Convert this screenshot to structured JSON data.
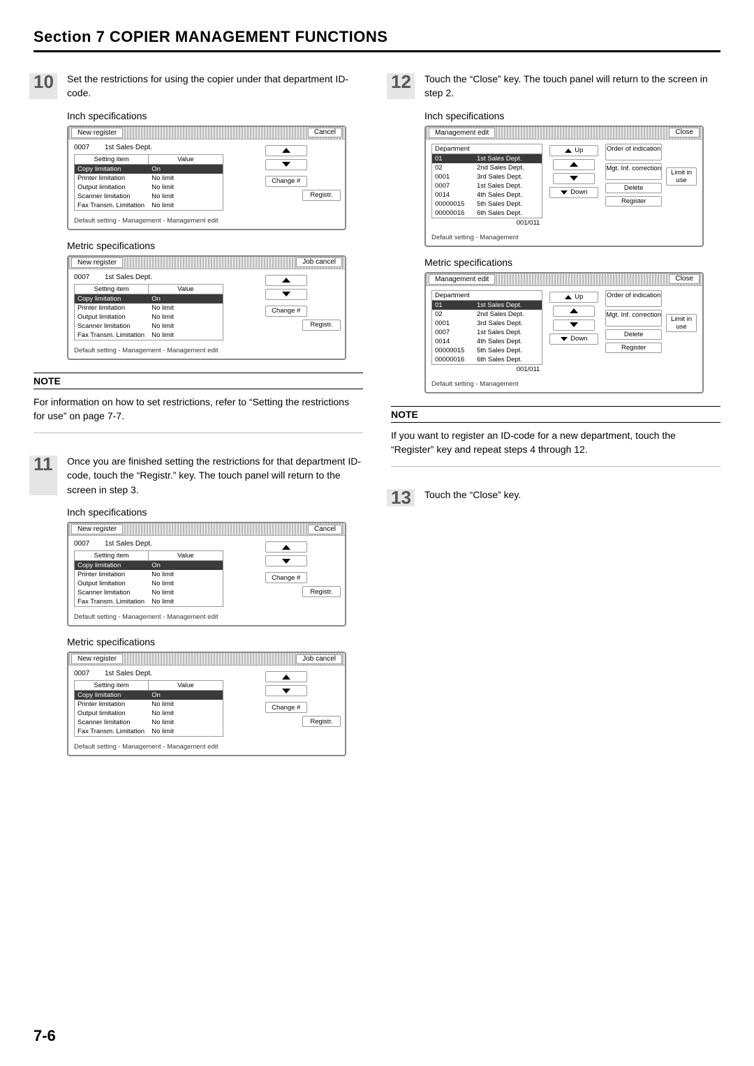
{
  "header": {
    "section_title": "Section 7  COPIER MANAGEMENT FUNCTIONS"
  },
  "labels": {
    "inch_spec": "Inch specifications",
    "metric_spec": "Metric specifications",
    "note": "NOTE"
  },
  "steps": {
    "s10": {
      "num": "10",
      "text": "Set the restrictions for using the copier under that department ID-code."
    },
    "s11": {
      "num": "11",
      "text": "Once you are finished setting the restrictions for that department ID-code, touch the “Registr.” key.\nThe touch panel will return to the screen in step 3."
    },
    "s12": {
      "num": "12",
      "text": "Touch the “Close” key.\nThe touch panel will return to the screen in step 2."
    },
    "s13": {
      "num": "13",
      "text": "Touch the “Close” key."
    }
  },
  "notes": {
    "left": "For information on how to set restrictions, refer to “Setting the restrictions for use” on page 7-7.",
    "right": "If you want to register an ID-code for a new department, touch the “Register” key and repeat steps 4 through 12."
  },
  "panel_register": {
    "title": "New register",
    "cancel": "Cancel",
    "job_cancel": "Job cancel",
    "dept_id": "0007",
    "dept_name": "1st Sales Dept.",
    "col_item": "Setting item",
    "col_value": "Value",
    "rows": [
      {
        "item": "Copy limitation",
        "value": "On",
        "sel": true
      },
      {
        "item": "Printer limitation",
        "value": "No limit",
        "sel": false
      },
      {
        "item": "Output limitation",
        "value": "No limit",
        "sel": false
      },
      {
        "item": "Scanner limitation",
        "value": "No limit",
        "sel": false
      },
      {
        "item": "Fax Transm. Limitation",
        "value": "No limit",
        "sel": false
      }
    ],
    "change": "Change #",
    "registr": "Registr.",
    "footer": "Default setting - Management - Management edit"
  },
  "panel_mgmt": {
    "title": "Management edit",
    "close": "Close",
    "dept_hdr": "Department",
    "rows": [
      {
        "id": "01",
        "name": "1st Sales Dept.",
        "sel": true
      },
      {
        "id": "02",
        "name": "2nd Sales Dept.",
        "sel": false
      },
      {
        "id": "0001",
        "name": "3rd Sales Dept.",
        "sel": false
      },
      {
        "id": "0007",
        "name": "1st Sales Dept.",
        "sel": false
      },
      {
        "id": "0014",
        "name": "4th Sales Dept.",
        "sel": false
      },
      {
        "id": "00000015",
        "name": "5th Sales Dept.",
        "sel": false
      },
      {
        "id": "00000016",
        "name": "6th Sales Dept.",
        "sel": false
      }
    ],
    "counter": "001/011",
    "up": "Up",
    "down": "Down",
    "order": "Order of indication",
    "mgtinf": "Mgt. Inf. correction",
    "delete": "Delete",
    "register": "Register",
    "limit": "Limit in use",
    "footer": "Default setting - Management"
  },
  "page_number": "7-6"
}
